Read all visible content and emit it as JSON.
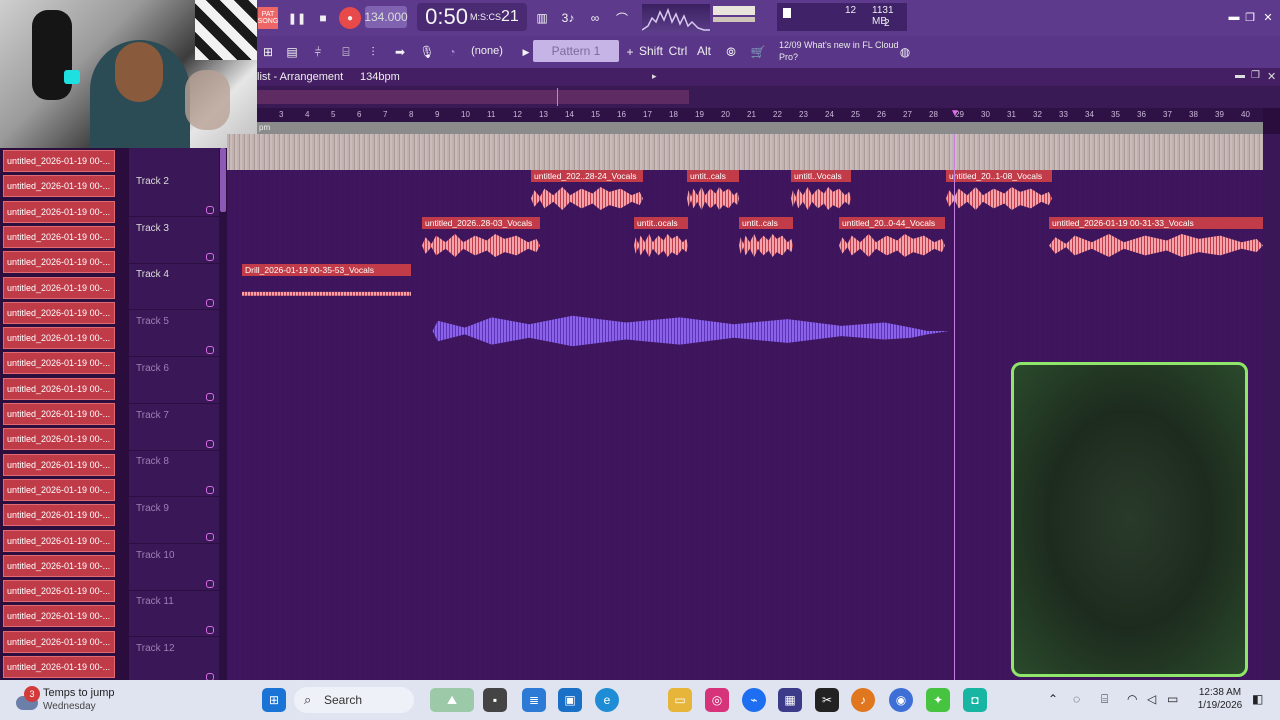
{
  "app": {
    "mode_label_top": "PAT",
    "mode_label_bottom": "SONG",
    "tempo": "134.000",
    "time_display": "0:50",
    "time_sub": "21",
    "time_ms_label": "M:S:CS",
    "cpu_value": "12",
    "memory": "1131 MB",
    "polyphony": "2",
    "preset": "(none)",
    "pattern": "Pattern 1",
    "keys": [
      "Shift",
      "Ctrl",
      "Alt"
    ],
    "news_date": "12/09",
    "news_text": "What's new in FL Cloud Pro?"
  },
  "playlist": {
    "title": "list - Arrangement",
    "tempo_label": "134bpm",
    "ruler_marks": [
      "3",
      "4",
      "5",
      "6",
      "7",
      "8",
      "9",
      "10",
      "11",
      "12",
      "13",
      "14",
      "15",
      "16",
      "17",
      "18",
      "19",
      "20",
      "21",
      "22",
      "23",
      "24",
      "25",
      "26",
      "27",
      "28",
      "29",
      "30",
      "31",
      "32",
      "33",
      "34",
      "35",
      "36",
      "37",
      "38",
      "39",
      "40"
    ],
    "ruler_prefix": "pm"
  },
  "picker_items": [
    "untitled_2026-01-19 00-...",
    "untitled_2026-01-19 00-...",
    "untitled_2026-01-19 00-...",
    "untitled_2026-01-19 00-...",
    "untitled_2026-01-19 00-...",
    "untitled_2026-01-19 00-...",
    "untitled_2026-01-19 00-...",
    "untitled_2026-01-19 00-...",
    "untitled_2026-01-19 00-...",
    "untitled_2026-01-19 00-...",
    "untitled_2026-01-19 00-...",
    "untitled_2026-01-19 00-...",
    "untitled_2026-01-19 00-...",
    "untitled_2026-01-19 00-...",
    "untitled_2026-01-19 00-...",
    "untitled_2026-01-19 00-...",
    "untitled_2026-01-19 00-...",
    "untitled_2026-01-19 00-...",
    "untitled_2026-01-19 00-...",
    "untitled_2026-01-19 00-...",
    "untitled_2026-01-19 00-..."
  ],
  "tracks": [
    "Track 2",
    "Track 3",
    "Track 4",
    "Track 5",
    "Track 6",
    "Track 7",
    "Track 8",
    "Track 9",
    "Track 10",
    "Track 11",
    "Track 12"
  ],
  "clips": {
    "t2a": "untitled_202..28-24_Vocals",
    "t2b": "untit..cals",
    "t2c": "untitl..Vocals",
    "t2d": "untitled_20..1-08_Vocals",
    "t3a": "untitled_2026..28-03_Vocals",
    "t3b": "untit..ocals",
    "t3c": "untit..cals",
    "t3d": "untitled_20..0-44_Vocals",
    "t3e": "untitled_2026-01-19 00-31-33_Vocals",
    "t4a": "Drill_2026-01-19 00-35-53_Vocals"
  },
  "taskbar": {
    "weather_title": "Temps to jump",
    "weather_sub": "Wednesday",
    "weather_badge": "3",
    "search": "Search",
    "time": "12:38 AM",
    "date": "1/19/2026"
  }
}
